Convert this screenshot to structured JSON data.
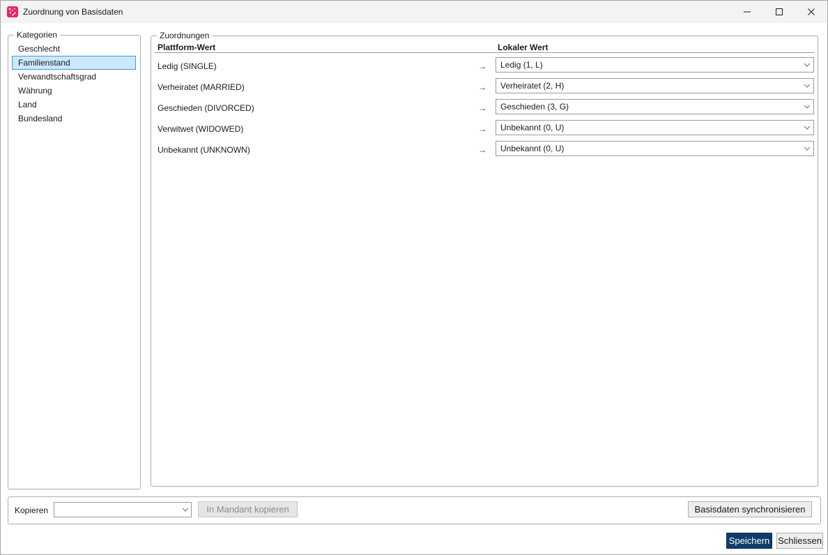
{
  "window": {
    "title": "Zuordnung von Basisdaten",
    "controls": {
      "minimize": "minimize-icon",
      "maximize": "maximize-icon",
      "close": "close-icon"
    }
  },
  "categories": {
    "legend": "Kategorien",
    "items": [
      {
        "label": "Geschlecht",
        "selected": false
      },
      {
        "label": "Familienstand",
        "selected": true
      },
      {
        "label": "Verwandtschaftsgrad",
        "selected": false
      },
      {
        "label": "Währung",
        "selected": false
      },
      {
        "label": "Land",
        "selected": false
      },
      {
        "label": "Bundesland",
        "selected": false
      }
    ]
  },
  "mappings": {
    "legend": "Zuordnungen",
    "columns": {
      "platform": "Plattform-Wert",
      "local": "Lokaler Wert"
    },
    "arrow": "→",
    "rows": [
      {
        "platform": "Ledig (SINGLE)",
        "local": "Ledig (1, L)"
      },
      {
        "platform": "Verheiratet (MARRIED)",
        "local": "Verheiratet (2, H)"
      },
      {
        "platform": "Geschieden (DIVORCED)",
        "local": "Geschieden (3, G)"
      },
      {
        "platform": "Verwitwet (WIDOWED)",
        "local": "Unbekannt (0, U)"
      },
      {
        "platform": "Unbekannt (UNKNOWN)",
        "local": "Unbekannt (0, U)"
      }
    ]
  },
  "copy": {
    "label": "Kopieren",
    "selected": "",
    "copy_button": "In Mandant kopieren",
    "sync_button": "Basisdaten synchronisieren"
  },
  "footer": {
    "save_button": "Speichern",
    "close_button": "Schliessen"
  },
  "colors": {
    "selection_bg": "#cce8ff",
    "selection_border": "#3d98d2",
    "primary_button": "#0e3d6b",
    "app_icon": "#e8265e"
  }
}
